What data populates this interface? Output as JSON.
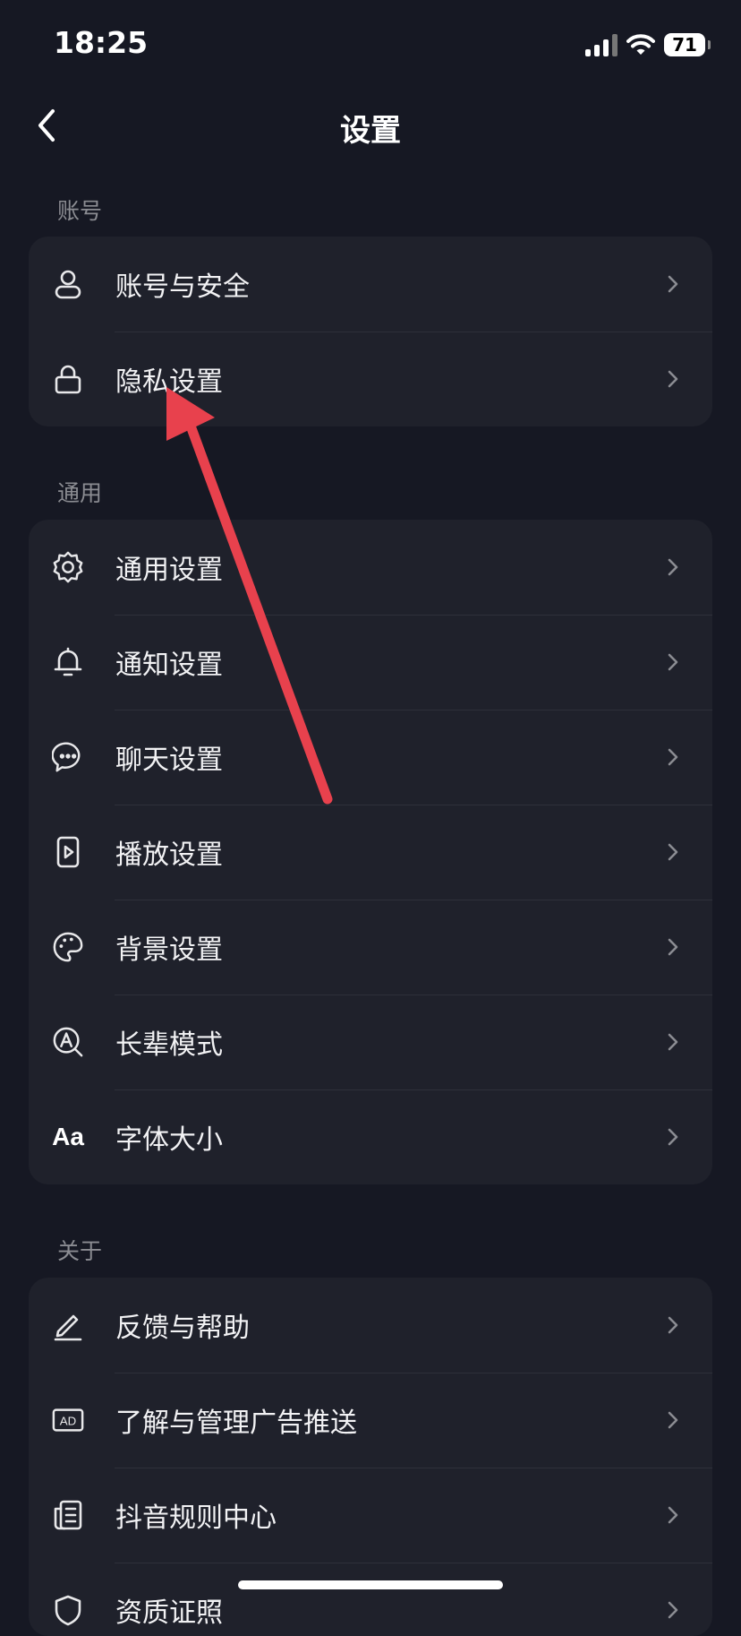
{
  "status_bar": {
    "time": "18:25",
    "battery": "71"
  },
  "nav": {
    "title": "设置"
  },
  "sections": {
    "account": {
      "label": "账号",
      "items": [
        {
          "label": "账号与安全",
          "icon": "user-icon"
        },
        {
          "label": "隐私设置",
          "icon": "lock-icon"
        }
      ]
    },
    "general": {
      "label": "通用",
      "items": [
        {
          "label": "通用设置",
          "icon": "gear-icon"
        },
        {
          "label": "通知设置",
          "icon": "bell-icon"
        },
        {
          "label": "聊天设置",
          "icon": "chat-bubble-icon"
        },
        {
          "label": "播放设置",
          "icon": "play-icon"
        },
        {
          "label": "背景设置",
          "icon": "palette-icon"
        },
        {
          "label": "长辈模式",
          "icon": "elder-mode-icon"
        },
        {
          "label": "字体大小",
          "icon": "font-size-icon",
          "icon_text": "Aa"
        }
      ]
    },
    "about": {
      "label": "关于",
      "items": [
        {
          "label": "反馈与帮助",
          "icon": "pencil-icon"
        },
        {
          "label": "了解与管理广告推送",
          "icon": "ad-icon",
          "icon_text": "AD"
        },
        {
          "label": "抖音规则中心",
          "icon": "document-icon"
        },
        {
          "label": "资质证照",
          "icon": "shield-icon"
        }
      ]
    }
  },
  "colors": {
    "background": "#161823",
    "card": "#1f212b",
    "section_label": "#8b8c92",
    "annotation_arrow": "#e8414d"
  }
}
